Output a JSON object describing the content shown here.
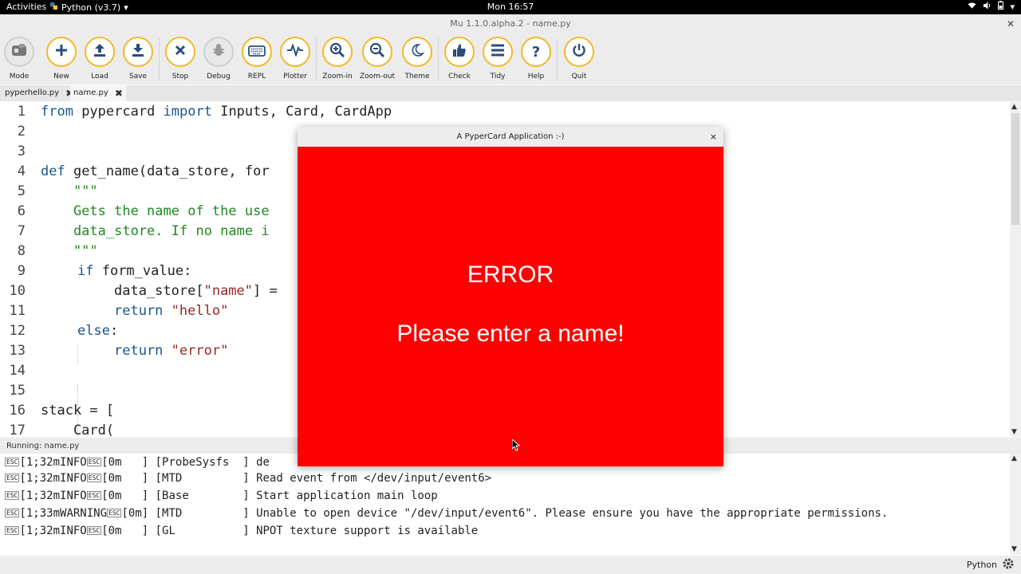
{
  "topbar": {
    "activities": "Activities",
    "app_menu": "Python (v3.7)",
    "clock": "Mon 16:57"
  },
  "window": {
    "title": "Mu 1.1.0.alpha.2 - name.py"
  },
  "toolbar": {
    "buttons": [
      {
        "label": "Mode",
        "icon": "mode-icon"
      },
      {
        "label": "New",
        "icon": "plus-icon"
      },
      {
        "label": "Load",
        "icon": "upload-icon"
      },
      {
        "label": "Save",
        "icon": "download-icon"
      },
      {
        "label": "Stop",
        "icon": "close-icon"
      },
      {
        "label": "Debug",
        "icon": "bug-icon"
      },
      {
        "label": "REPL",
        "icon": "keyboard-icon"
      },
      {
        "label": "Plotter",
        "icon": "pulse-icon"
      },
      {
        "label": "Zoom-in",
        "icon": "zoom-in-icon"
      },
      {
        "label": "Zoom-out",
        "icon": "zoom-out-icon"
      },
      {
        "label": "Theme",
        "icon": "moon-icon"
      },
      {
        "label": "Check",
        "icon": "thumbs-up-icon"
      },
      {
        "label": "Tidy",
        "icon": "lines-icon"
      },
      {
        "label": "Help",
        "icon": "question-icon"
      },
      {
        "label": "Quit",
        "icon": "power-icon"
      }
    ]
  },
  "tabs": [
    {
      "label": "pyperhello.py",
      "active": false
    },
    {
      "label": "name.py",
      "active": true
    }
  ],
  "editor": {
    "line_numbers": [
      "1",
      "2",
      "3",
      "4",
      "5",
      "6",
      "7",
      "8",
      "9",
      "10",
      "11",
      "12",
      "13",
      "14",
      "15",
      "16",
      "17"
    ],
    "code": {
      "l1_from": "from",
      "l1_mod": " pypercard ",
      "l1_import": "import",
      "l1_rest": " Inputs, Card, CardApp",
      "l4_def": "def",
      "l4_rest": " get_name(data_store, for",
      "l5": "    \"\"\"",
      "l6": "    Gets the name of the use",
      "l7": "    data_store. If no name i",
      "l8": "    \"\"\"",
      "l9_if": "if",
      "l9_rest": " form_value:",
      "l10_a": "data_store[",
      "l10_s": "\"name\"",
      "l10_b": "] =",
      "l11_ret": "return",
      "l11_s": "\"hello\"",
      "l12_else": "else",
      "l13_ret": "return",
      "l13_s": "\"error\"",
      "l16": "stack = [",
      "l17": "    Card("
    }
  },
  "status": {
    "running": "Running: name.py"
  },
  "console": {
    "esc": "ESC",
    "lines": [
      {
        "pre": "[1;32mINFO",
        "mid": "[0m   ] [ProbeSysfs  ] ",
        "msg": "de"
      },
      {
        "pre": "[1;32mINFO",
        "mid": "[0m   ] [MTD         ] ",
        "msg": "Read event from </dev/input/event6>"
      },
      {
        "pre": "[1;32mINFO",
        "mid": "[0m   ] [Base        ] ",
        "msg": "Start application main loop"
      },
      {
        "pre": "[1;33mWARNING",
        "mid": "[0m] [MTD         ] ",
        "msg": "Unable to open device \"/dev/input/event6\". Please ensure you have the appropriate permissions."
      },
      {
        "pre": "[1;32mINFO",
        "mid": "[0m   ] [GL          ] ",
        "msg": "NPOT texture support is available"
      }
    ]
  },
  "bottombar": {
    "mode": "Python"
  },
  "popup": {
    "title": "A PyperCard Application :-)",
    "close": "×",
    "heading": "ERROR",
    "message": "Please enter a name!",
    "background": "#ff0000"
  },
  "colors": {
    "accent": "#f1b928",
    "error_bg": "#ff0000"
  }
}
